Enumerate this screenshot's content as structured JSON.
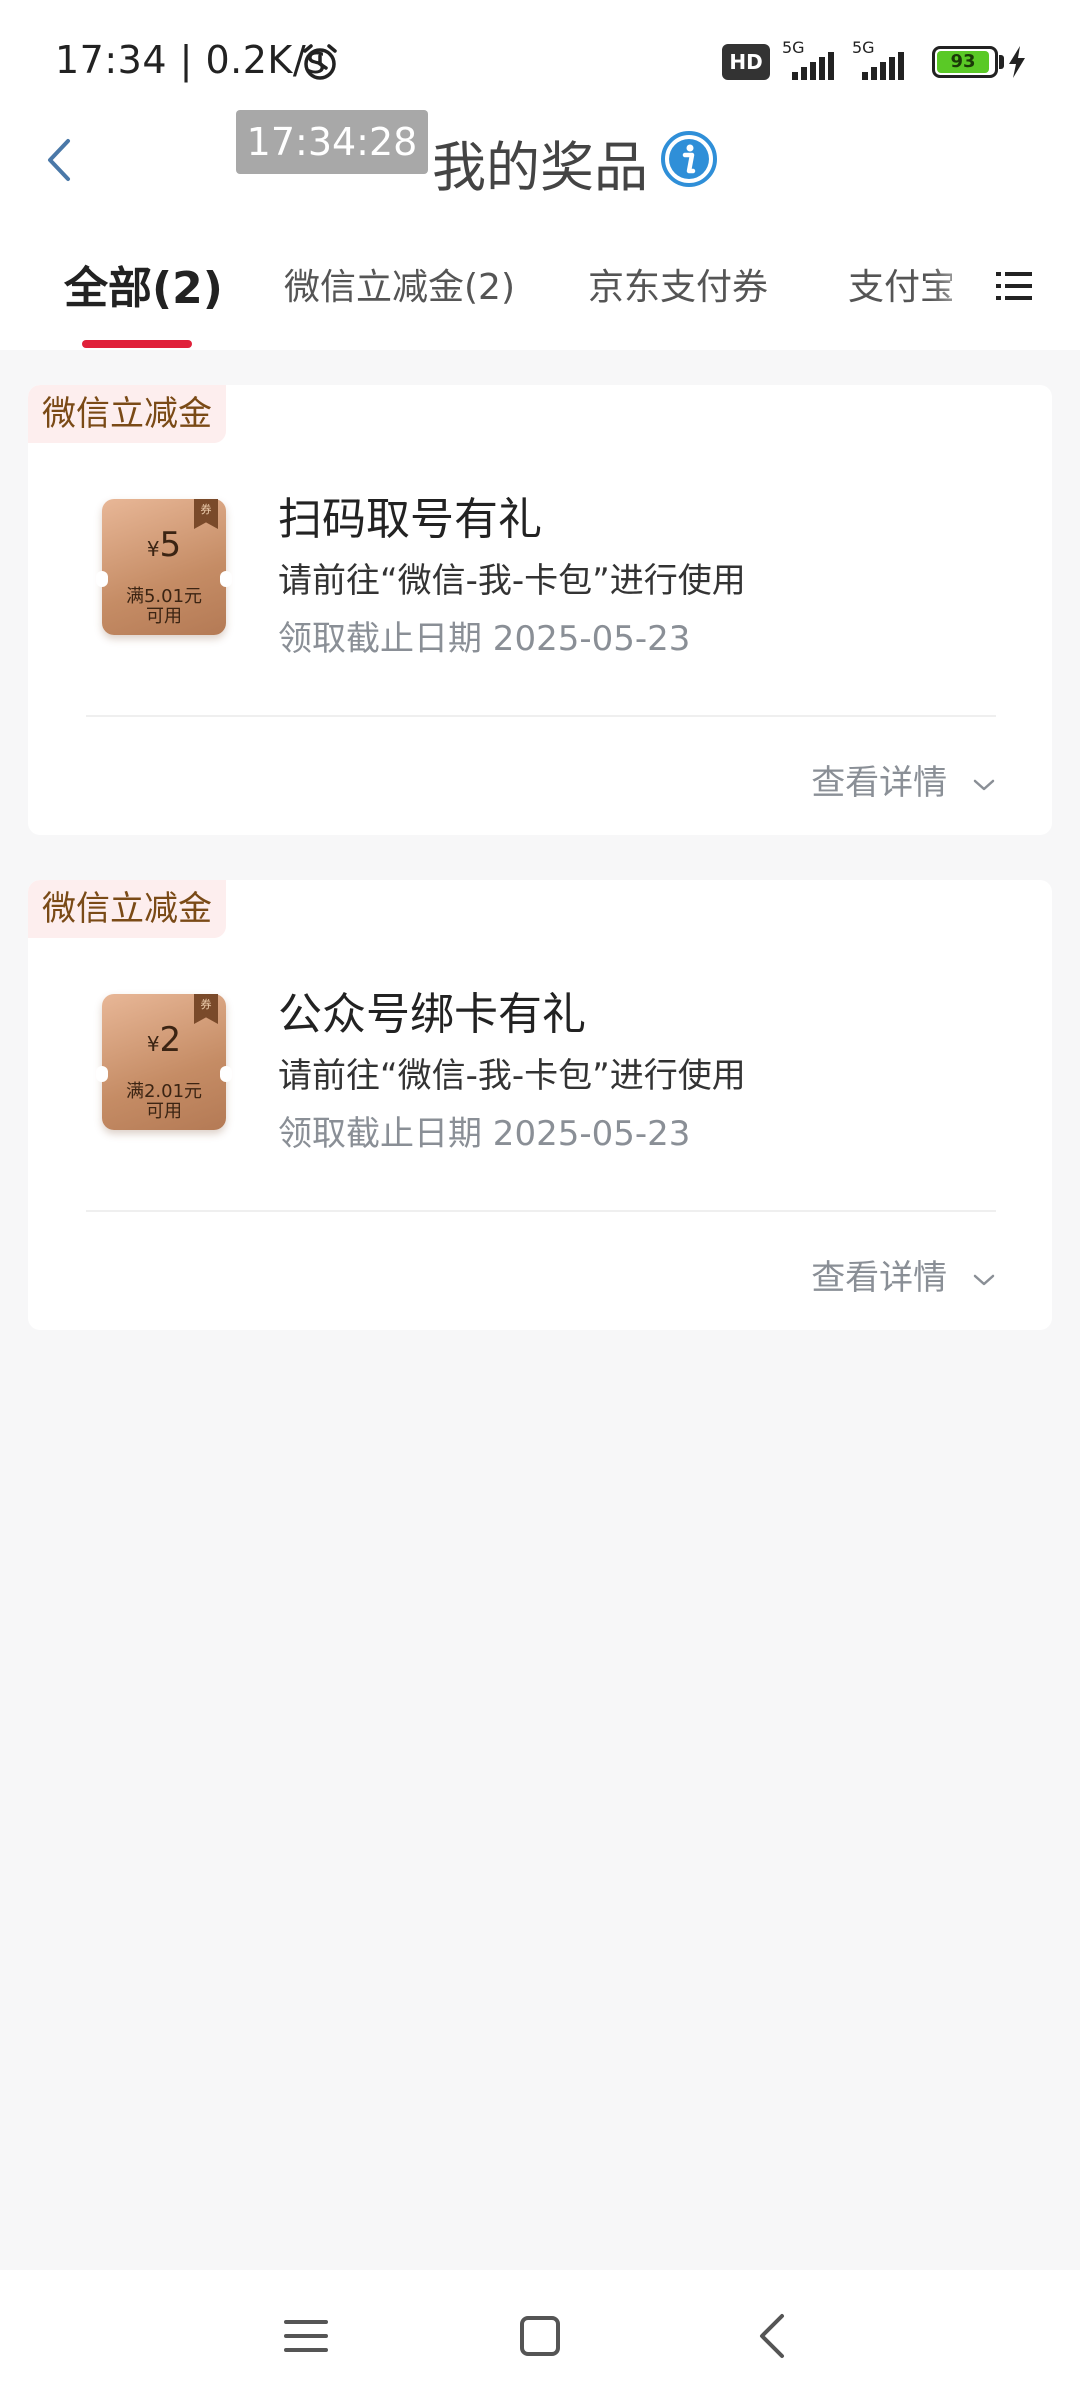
{
  "status_bar": {
    "time_text": "17:34 | 0.2K/s",
    "hd_label": "HD",
    "signal_1_label": "5G",
    "signal_2_label": "5G",
    "battery_level": "93",
    "icons": [
      "alarm-clock-icon",
      "signal-icon",
      "battery-icon",
      "charging-bolt-icon"
    ]
  },
  "header": {
    "time_chip": "17:34:28",
    "title": "我的奖品",
    "icons": [
      "back-arrow-icon",
      "info-icon"
    ]
  },
  "tabs": [
    {
      "label": "全部(2)",
      "active": true
    },
    {
      "label": "微信立减金(2)",
      "active": false
    },
    {
      "label": "京东支付券",
      "active": false
    },
    {
      "label": "支付宝",
      "active": false
    }
  ],
  "colors": {
    "accent": "#e0213a",
    "tag_bg": "#fdeeee",
    "tag_text": "#7a4a16",
    "info_blue": "#2f8fd8",
    "coupon": "#c58c65"
  },
  "prizes": [
    {
      "tag": "微信立减金",
      "coupon_currency": "¥",
      "coupon_amount": "5",
      "coupon_condition_1": "满5.01元",
      "coupon_condition_2": "可用",
      "coupon_badge": "券",
      "name": "扫码取号有礼",
      "description": "请前往“微信-我-卡包”进行使用",
      "deadline": "领取截止日期 2025-05-23",
      "details_label": "查看详情"
    },
    {
      "tag": "微信立减金",
      "coupon_currency": "¥",
      "coupon_amount": "2",
      "coupon_condition_1": "满2.01元",
      "coupon_condition_2": "可用",
      "coupon_badge": "券",
      "name": "公众号绑卡有礼",
      "description": "请前往“微信-我-卡包”进行使用",
      "deadline": "领取截止日期 2025-05-23",
      "details_label": "查看详情"
    }
  ],
  "nav_bar": {
    "icons": [
      "menu-icon",
      "home-square-icon",
      "back-icon"
    ]
  }
}
